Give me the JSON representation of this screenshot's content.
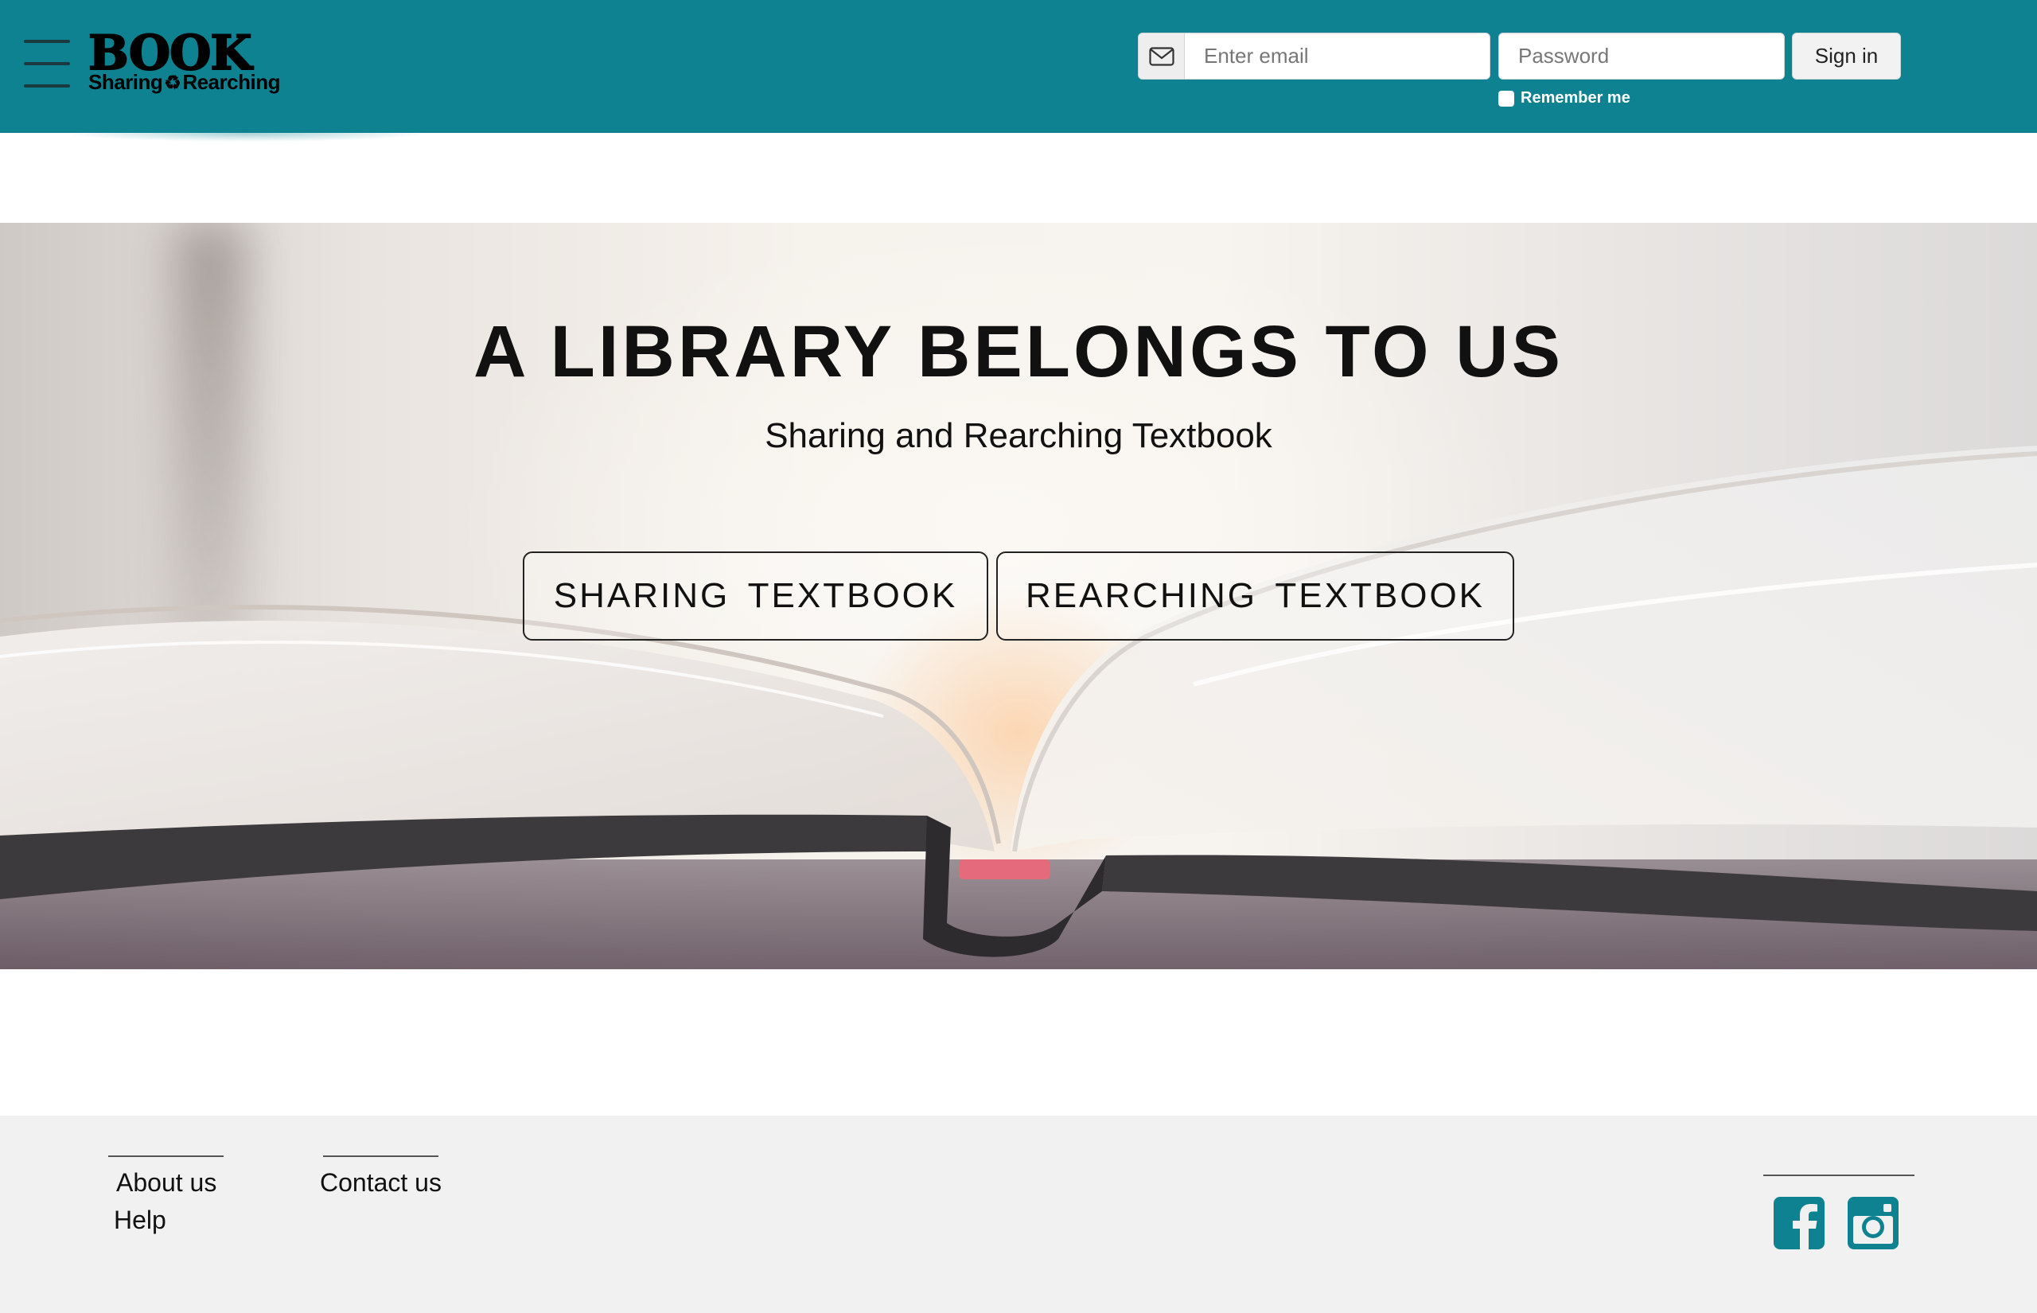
{
  "header": {
    "logo_title": "BOOK",
    "logo_sub_left": "Sharing",
    "logo_sub_right": "Rearching",
    "email_placeholder": "Enter email",
    "password_placeholder": "Password",
    "signin_label": "Sign in",
    "remember_label": "Remember me",
    "icons": [
      "menu-icon",
      "envelope-icon",
      "recycle-icon"
    ]
  },
  "hero": {
    "title": "A LIBRARY BELONGS TO US",
    "subtitle": "Sharing and Rearching Textbook",
    "buttons": [
      "SHARING TEXTBOOK",
      "REARCHING TEXTBOOK"
    ]
  },
  "footer": {
    "links": {
      "about": "About us",
      "help": "Help",
      "contact": "Contact us"
    },
    "social": [
      "facebook-icon",
      "instagram-icon"
    ]
  },
  "colors": {
    "brand": "#0e8290",
    "footer_bg": "#f1f1f1"
  }
}
